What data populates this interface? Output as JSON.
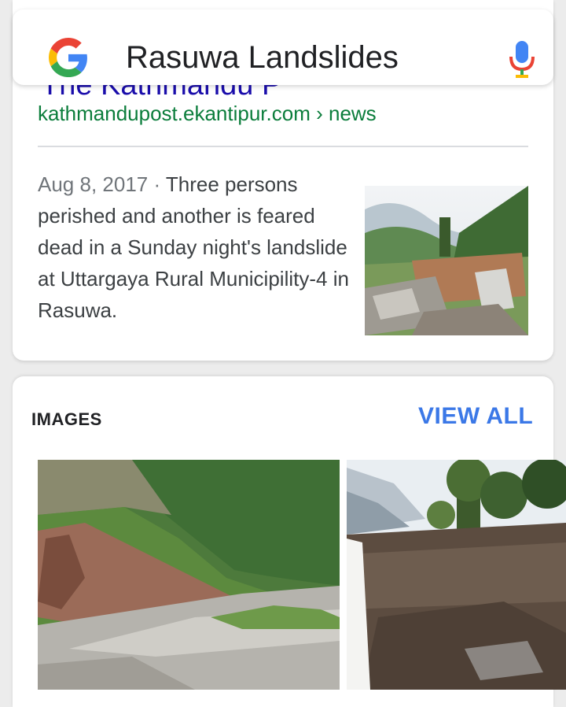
{
  "search": {
    "query": "Rasuwa Landslides"
  },
  "result": {
    "clipped_title": "The Kathmandu P",
    "url": "kathmandupost.ekantipur.com › news",
    "date": "Aug 8, 2017",
    "separator": " · ",
    "snippet": "Three persons perished and another is feared dead in a Sunday night's landslide at Uttargaya Rural Municipility-4 in Rasuwa."
  },
  "images_section": {
    "heading": "IMAGES",
    "view_all": "VIEW ALL"
  },
  "colors": {
    "link_blue": "#1a0dab",
    "url_green": "#0b7d3b",
    "accent_blue": "#3b78e7"
  },
  "icons": [
    "google-logo-icon",
    "microphone-icon"
  ]
}
